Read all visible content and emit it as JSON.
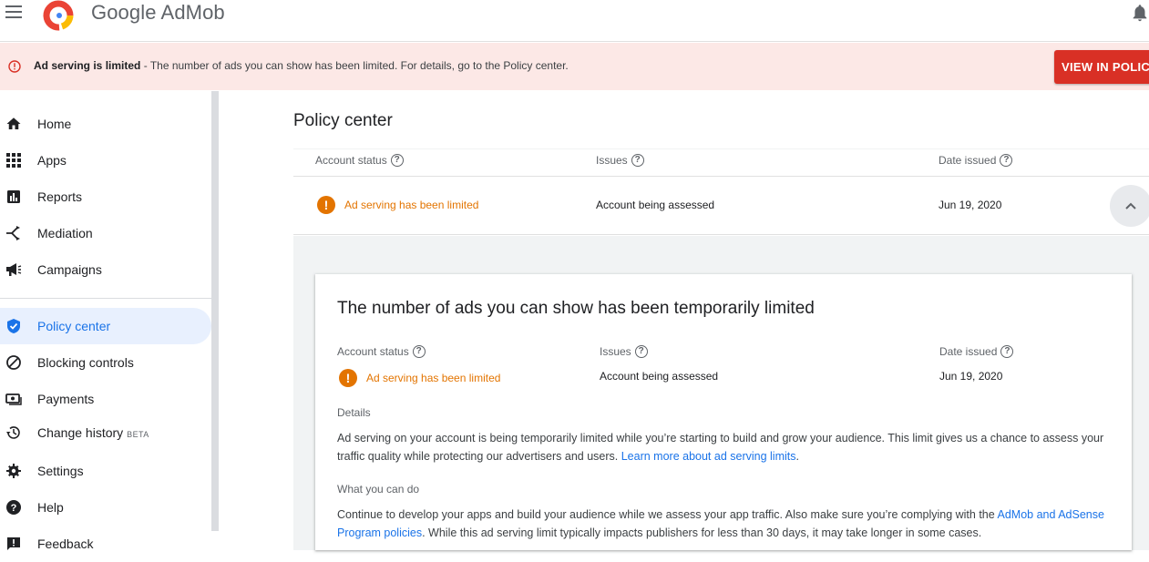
{
  "app": {
    "brand": "Google AdMob"
  },
  "banner": {
    "bold": "Ad serving is limited",
    "text": " - The number of ads you can show has been limited. For details, go to the Policy center.",
    "button": "VIEW IN POLICY CENTER"
  },
  "sidebar": {
    "items": [
      {
        "label": "Home",
        "icon": "home-icon"
      },
      {
        "label": "Apps",
        "icon": "apps-grid-icon"
      },
      {
        "label": "Reports",
        "icon": "reports-icon"
      },
      {
        "label": "Mediation",
        "icon": "mediation-icon"
      },
      {
        "label": "Campaigns",
        "icon": "megaphone-icon"
      },
      {
        "label": "Policy center",
        "icon": "shield-check-icon"
      },
      {
        "label": "Blocking controls",
        "icon": "block-icon"
      },
      {
        "label": "Payments",
        "icon": "payments-icon"
      },
      {
        "label": "Change history",
        "icon": "history-icon",
        "badge": "BETA"
      },
      {
        "label": "Settings",
        "icon": "gear-icon"
      },
      {
        "label": "Help",
        "icon": "help-icon"
      },
      {
        "label": "Feedback",
        "icon": "feedback-icon"
      }
    ]
  },
  "main": {
    "title": "Policy center",
    "table": {
      "headers": [
        "Account status",
        "Issues",
        "Date issued"
      ],
      "row": {
        "status": "Ad serving has been limited",
        "issue": "Account being assessed",
        "date": "Jun 19, 2020"
      }
    },
    "card": {
      "title": "The number of ads you can show has been temporarily limited",
      "headers": [
        "Account status",
        "Issues",
        "Date issued"
      ],
      "status": "Ad serving has been limited",
      "issue": "Account being assessed",
      "date": "Jun 19, 2020",
      "details_label": "Details",
      "details_text": "Ad serving on your account is being temporarily limited while you’re starting to build and grow your audience. This limit gives us a chance to assess your traffic quality while protecting our advertisers and users. ",
      "details_link": "Learn more about ad serving limits",
      "details_end": ".",
      "todo_label": "What you can do",
      "todo_text": "Continue to develop your apps and build your audience while we assess your app traffic. Also make sure you’re complying with the ",
      "todo_link": "AdMob and AdSense Program policies",
      "todo_end": ". While this ad serving limit typically impacts publishers for less than 30 days, it may take longer in some cases."
    }
  },
  "colors": {
    "accent": "#1a73e8",
    "warning": "#e37400",
    "error": "#d93025",
    "banner_bg": "#fce8e6"
  }
}
